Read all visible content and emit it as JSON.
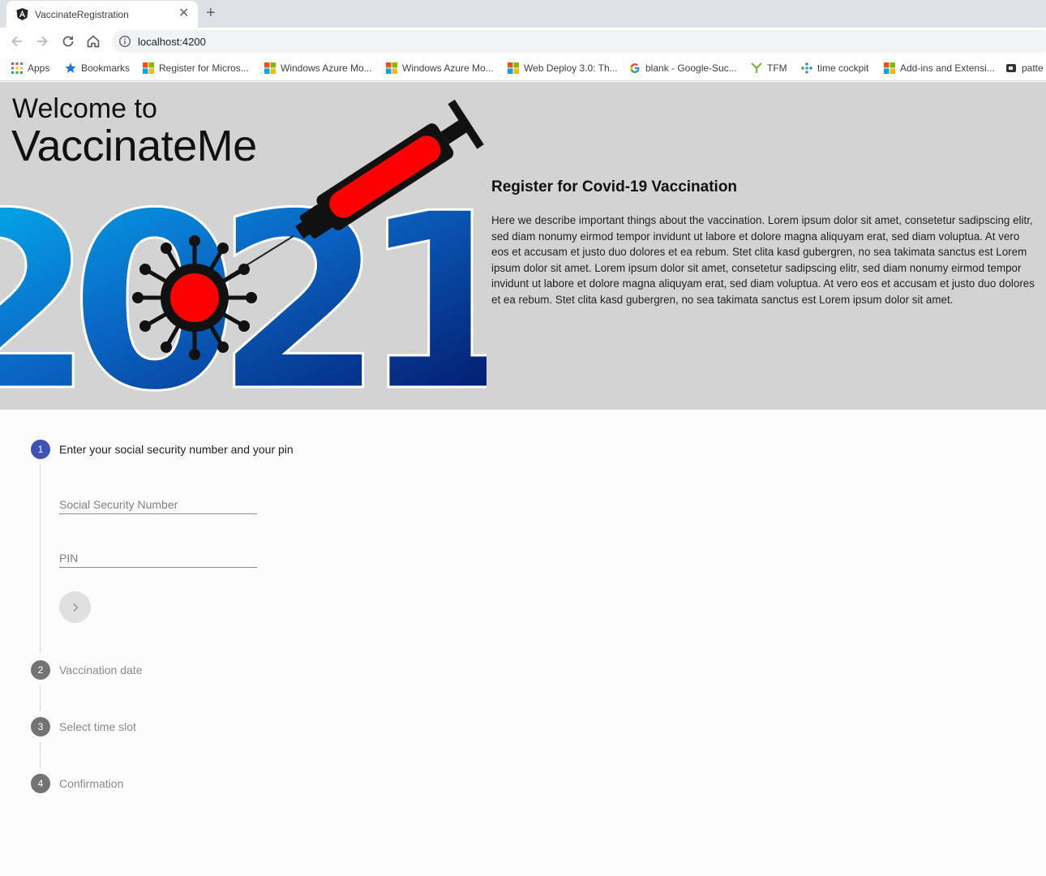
{
  "browser": {
    "tab_title": "VaccinateRegistration",
    "close_glyph": "✕",
    "new_tab_glyph": "+",
    "url": "localhost:4200"
  },
  "bookmarks": [
    {
      "label": "Apps",
      "icon": "apps-grid-icon"
    },
    {
      "label": "Bookmarks",
      "icon": "star-icon"
    },
    {
      "label": "Register for Micros...",
      "icon": "ms-logo-icon"
    },
    {
      "label": "Windows Azure Mo...",
      "icon": "ms-logo-icon"
    },
    {
      "label": "Windows Azure Mo...",
      "icon": "ms-logo-icon"
    },
    {
      "label": "Web Deploy 3.0: Th...",
      "icon": "ms-logo-icon"
    },
    {
      "label": "blank - Google-Suc...",
      "icon": "google-icon"
    },
    {
      "label": "TFM",
      "icon": "tfm-icon"
    },
    {
      "label": "time cockpit",
      "icon": "time-cockpit-icon"
    },
    {
      "label": "Add-ins and Extensi...",
      "icon": "ms-logo-icon"
    },
    {
      "label": "patte",
      "icon": "link-icon"
    }
  ],
  "hero": {
    "welcome": "Welcome to",
    "brand": "VaccinateMe",
    "year_art": "2021",
    "heading": "Register for Covid-19 Vaccination",
    "text": "Here we describe important things about the vaccination. Lorem ipsum dolor sit amet, consetetur sadipscing elitr, sed diam nonumy eirmod tempor invidunt ut labore et dolore magna aliquyam erat, sed diam voluptua. At vero eos et accusam et justo duo dolores et ea rebum. Stet clita kasd gubergren, no sea takimata sanctus est Lorem ipsum dolor sit amet. Lorem ipsum dolor sit amet, consetetur sadipscing elitr, sed diam nonumy eirmod tempor invidunt ut labore et dolore magna aliquyam erat, sed diam voluptua. At vero eos et accusam et justo duo dolores et ea rebum. Stet clita kasd gubergren, no sea takimata sanctus est Lorem ipsum dolor sit amet."
  },
  "stepper": {
    "steps": [
      {
        "number": "1",
        "label": "Enter your social security number and your pin",
        "active": true
      },
      {
        "number": "2",
        "label": "Vaccination date",
        "active": false
      },
      {
        "number": "3",
        "label": "Select time slot",
        "active": false
      },
      {
        "number": "4",
        "label": "Confirmation",
        "active": false
      }
    ],
    "fields": {
      "ssn_placeholder": "Social Security Number",
      "ssn_value": "",
      "pin_placeholder": "PIN",
      "pin_value": ""
    },
    "next_icon": "chevron-right-icon"
  },
  "colors": {
    "active_step": "#3f51b5",
    "idle_step": "#737373",
    "hero_background": "#d3d3d3",
    "syringe_red": "#ff0000"
  }
}
